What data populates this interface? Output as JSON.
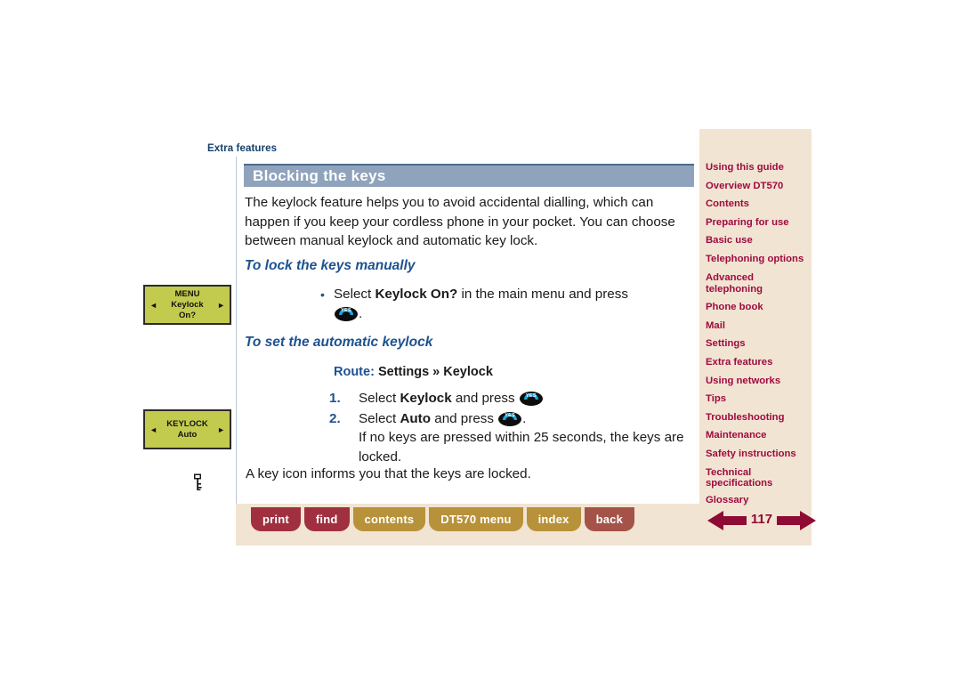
{
  "breadcrumb": "Extra features",
  "section": {
    "title": "Blocking the keys",
    "intro": "The keylock feature helps you to avoid accidental dialling, which can happen if you keep your cordless phone in your pocket. You can choose between manual keylock and automatic key lock."
  },
  "subheadings": {
    "manual": "To lock the keys manually",
    "automatic": "To set the automatic keylock"
  },
  "bullet": {
    "marker": "•",
    "text_before": "Select ",
    "bold": "Keylock On?",
    "text_after": " in the main menu and press",
    "trailing": "."
  },
  "route": {
    "label": "Route:",
    "path": "Settings » Keylock"
  },
  "steps": [
    {
      "number": "1.",
      "text_before": "Select ",
      "bold": "Keylock",
      "text_after": " and press ",
      "extra": ""
    },
    {
      "number": "2.",
      "text_before": "Select ",
      "bold": "Auto",
      "text_after": " and press ",
      "extra": "If no keys are pressed within 25 seconds, the keys are locked."
    }
  ],
  "closing": "A key icon informs you that the keys are locked.",
  "lcd_displays": [
    {
      "line1": "MENU",
      "line2": "Keylock",
      "line3": "On?",
      "arrow_left": "◄",
      "arrow_right": "►"
    },
    {
      "line1": "KEYLOCK",
      "line2": "Auto",
      "line3": "",
      "arrow_left": "◄",
      "arrow_right": "►"
    }
  ],
  "sidebar": {
    "items": [
      "Using this guide",
      "Overview DT570",
      "Contents",
      "Preparing for use",
      "Basic use",
      "Telephoning options",
      "Advanced telephoning",
      "Phone book",
      "Mail",
      "Settings",
      "Extra features",
      "Using networks",
      "Tips",
      "Troubleshooting",
      "Maintenance",
      "Safety instructions",
      "Technical specifications",
      "Glossary"
    ]
  },
  "footer": {
    "buttons": [
      {
        "label": "print",
        "style": "red"
      },
      {
        "label": "find",
        "style": "red"
      },
      {
        "label": "contents",
        "style": "gold"
      },
      {
        "label": "DT570 menu",
        "style": "gold"
      },
      {
        "label": "index",
        "style": "gold"
      },
      {
        "label": "back",
        "style": "back"
      }
    ],
    "page_number": "117"
  },
  "icons": {
    "yes_button": "yes-call-button-icon",
    "key": "key-icon",
    "prev": "arrow-left-icon",
    "next": "arrow-right-icon"
  },
  "colors": {
    "title_bar": "#8fa3bc",
    "sidebar_bg": "#f2e4d2",
    "sidebar_link": "#9e0b3f",
    "heading_blue": "#1d5291",
    "breadcrumb": "#13406b",
    "lcd_green": "#c3cb4f",
    "footer_red": "#a03040",
    "footer_gold": "#b8923a",
    "footer_back": "#a55348",
    "pager_arrow": "#8e0b36"
  }
}
